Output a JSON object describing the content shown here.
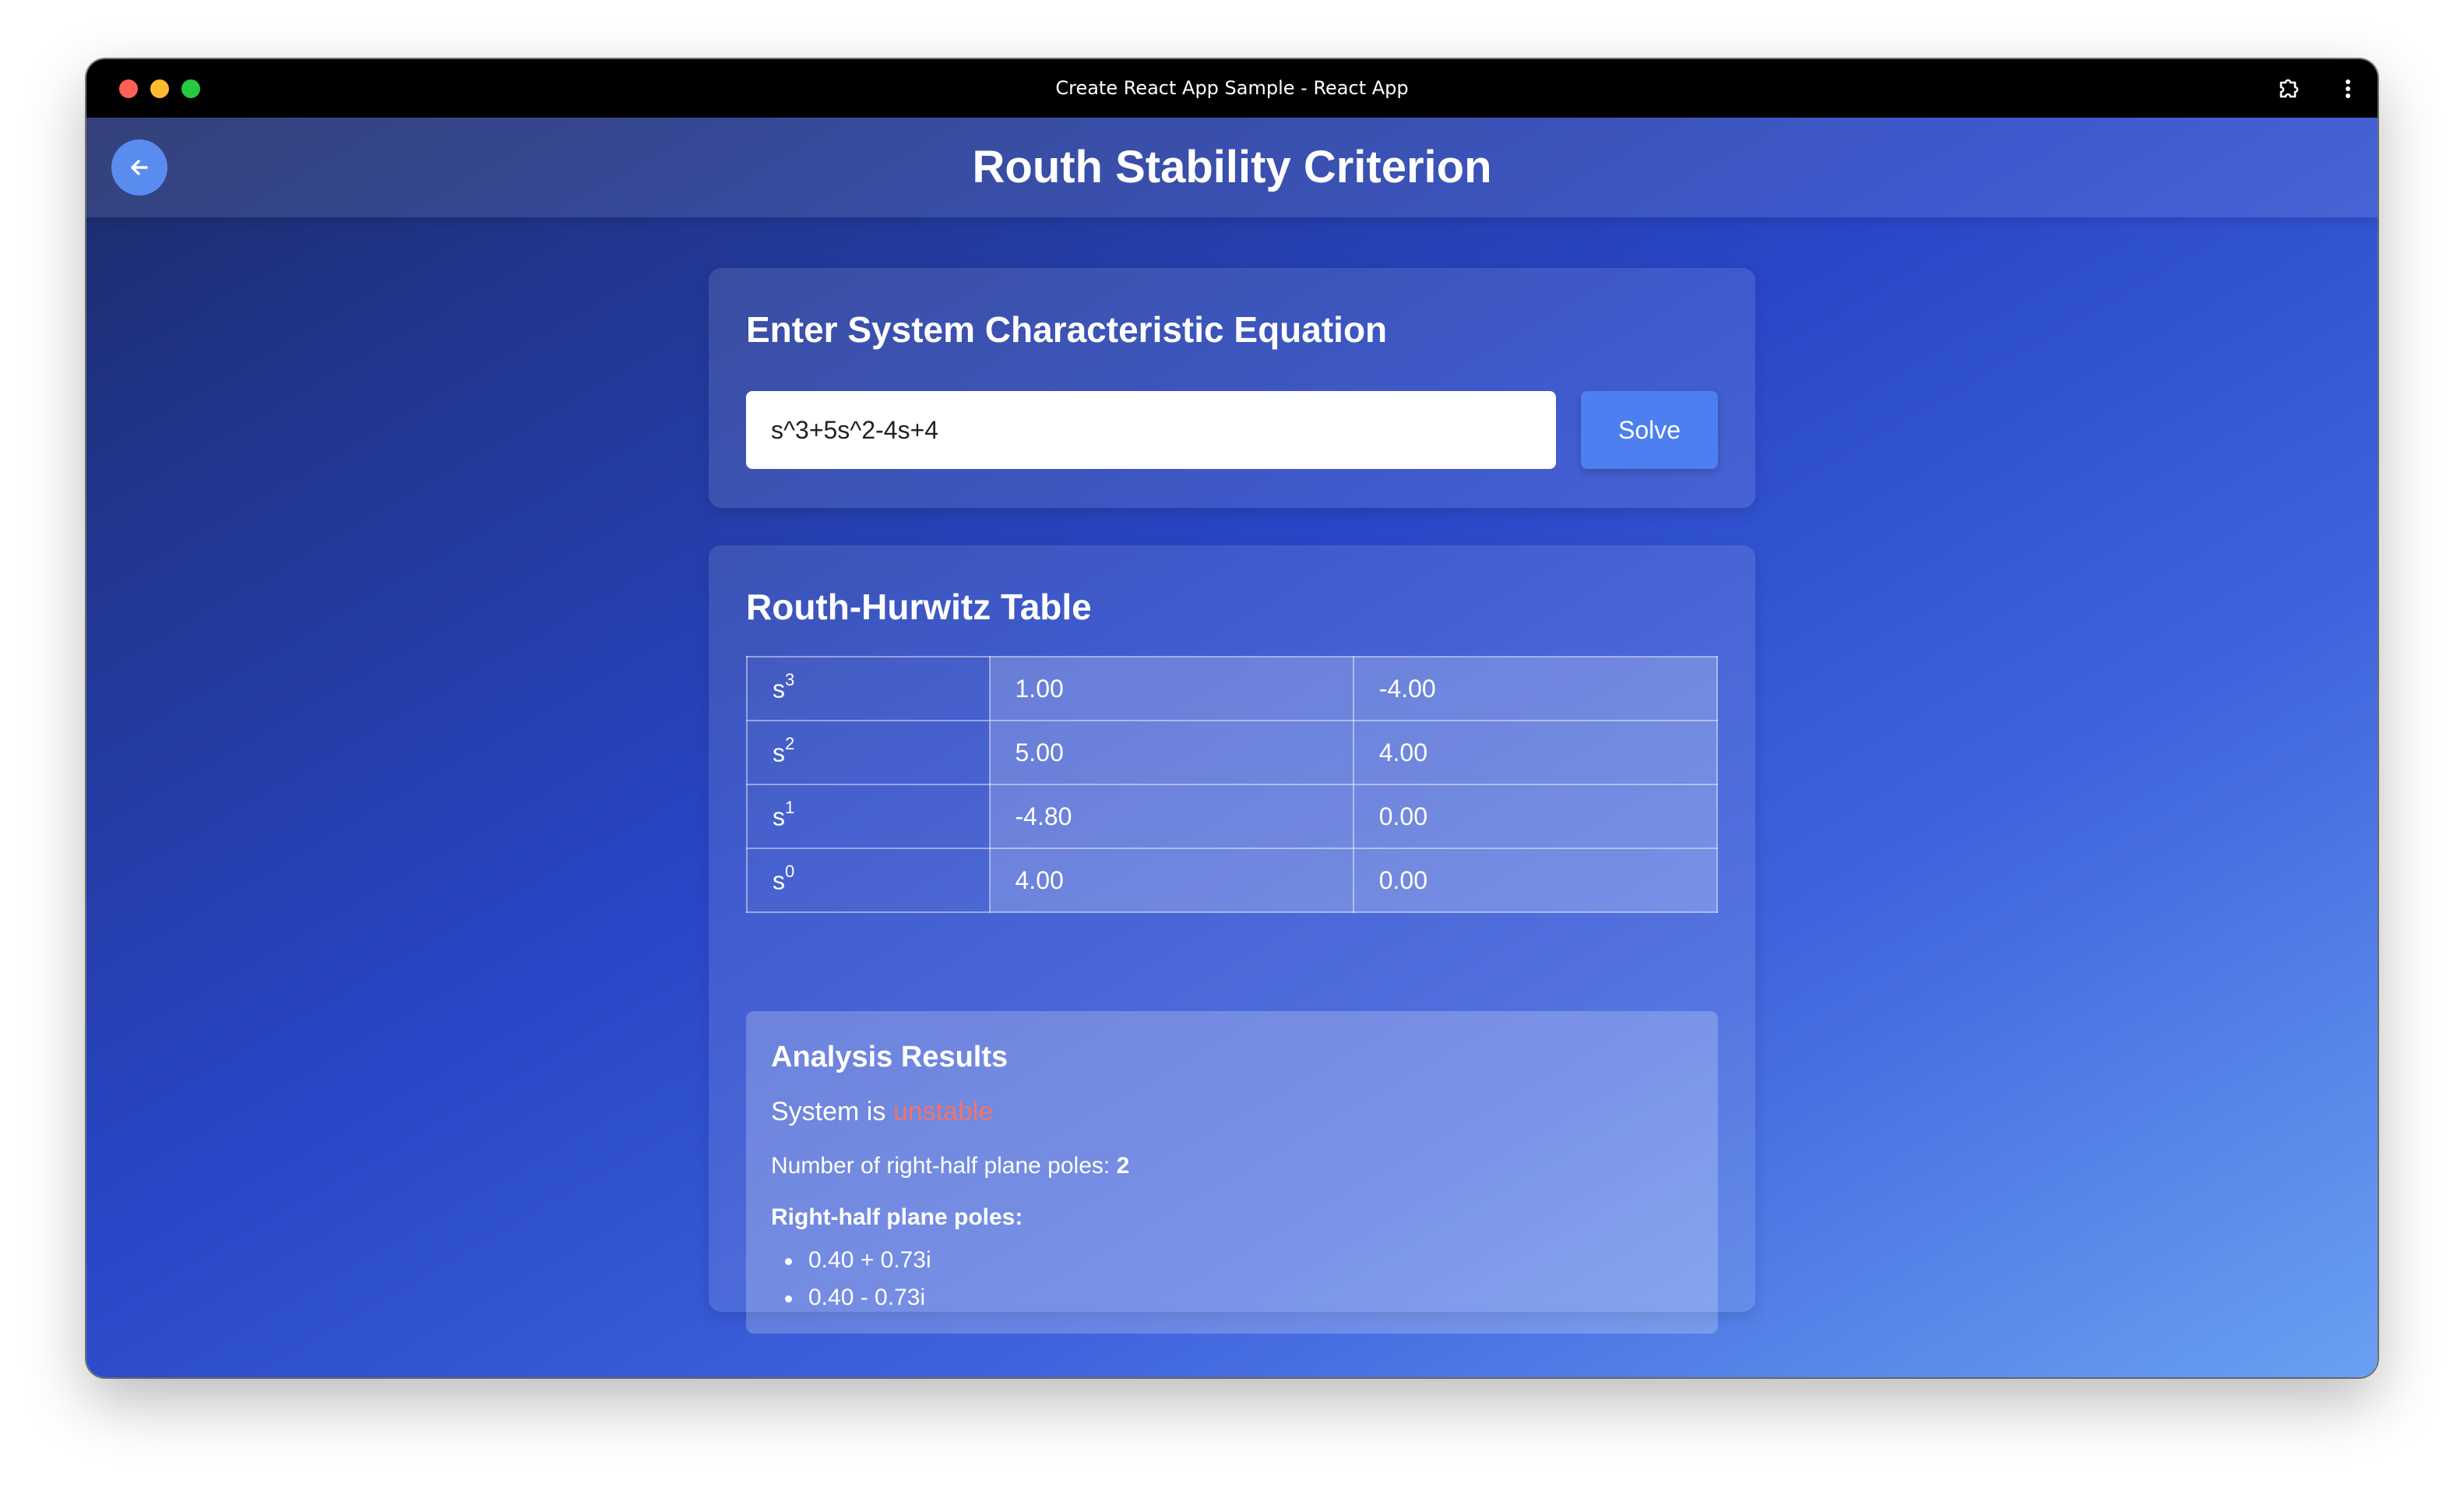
{
  "browser": {
    "window_title": "Create React App Sample - React App"
  },
  "header": {
    "title": "Routh Stability Criterion"
  },
  "equation_card": {
    "title": "Enter System Characteristic Equation",
    "input_value": "s^3+5s^2-4s+4",
    "solve_label": "Solve"
  },
  "table_card": {
    "title": "Routh-Hurwitz Table",
    "rows": [
      {
        "base": "s",
        "power": "3",
        "values": [
          "1.00",
          "-4.00"
        ]
      },
      {
        "base": "s",
        "power": "2",
        "values": [
          "5.00",
          "4.00"
        ]
      },
      {
        "base": "s",
        "power": "1",
        "values": [
          "-4.80",
          "0.00"
        ]
      },
      {
        "base": "s",
        "power": "0",
        "values": [
          "4.00",
          "0.00"
        ]
      }
    ]
  },
  "analysis": {
    "title": "Analysis Results",
    "status_prefix": "System is ",
    "status_value": "unstable",
    "poles_count_label": "Number of right-half plane poles: ",
    "poles_count_value": "2",
    "poles_label": "Right-half plane poles:",
    "poles": [
      "0.40 + 0.73i",
      "0.40 - 0.73i"
    ]
  },
  "colors": {
    "accent": "#4d7ff0",
    "unstable": "#f0746a",
    "back_button": "#5a8cf0"
  }
}
